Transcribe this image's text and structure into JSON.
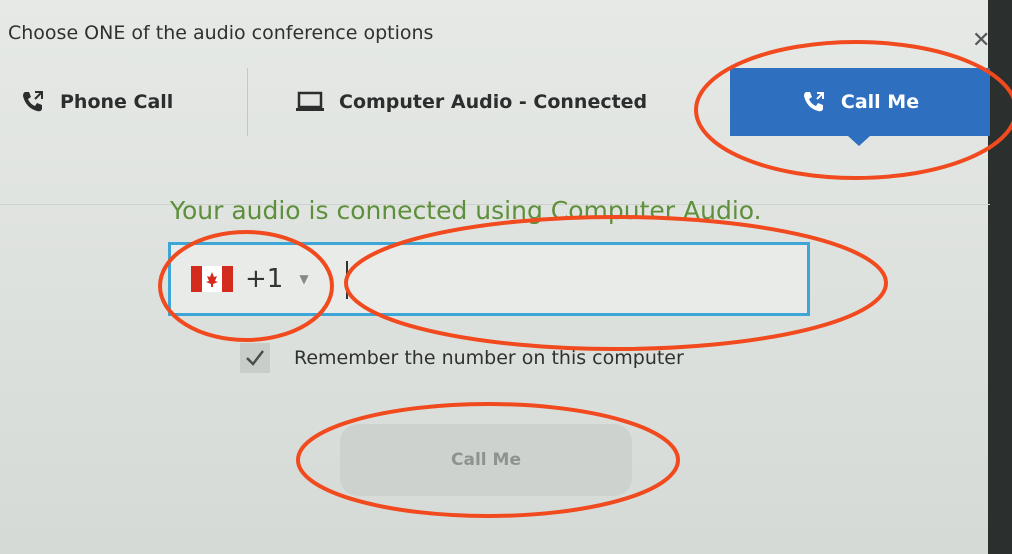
{
  "dialog": {
    "title": "Choose ONE of the audio conference options",
    "close_icon": "close-icon"
  },
  "tabs": [
    {
      "label": "Phone Call",
      "icon": "phone-icon",
      "selected": false
    },
    {
      "label": "Computer Audio - Connected",
      "icon": "laptop-icon",
      "selected": false
    },
    {
      "label": "Call Me",
      "icon": "phone-outgoing-icon",
      "selected": true
    }
  ],
  "status_message": "Your audio is connected using Computer Audio.",
  "phone": {
    "country_code": "+1",
    "country_flag": "canada-flag-icon",
    "number_value": "",
    "placeholder": ""
  },
  "remember": {
    "label": "Remember the number on this computer",
    "checked": true
  },
  "call_button": {
    "label": "Call Me",
    "enabled": false
  },
  "colors": {
    "accent": "#2f6fc0",
    "status_green": "#5e8f3a",
    "input_border": "#3da6d6",
    "annotation": "#f04a1e"
  }
}
